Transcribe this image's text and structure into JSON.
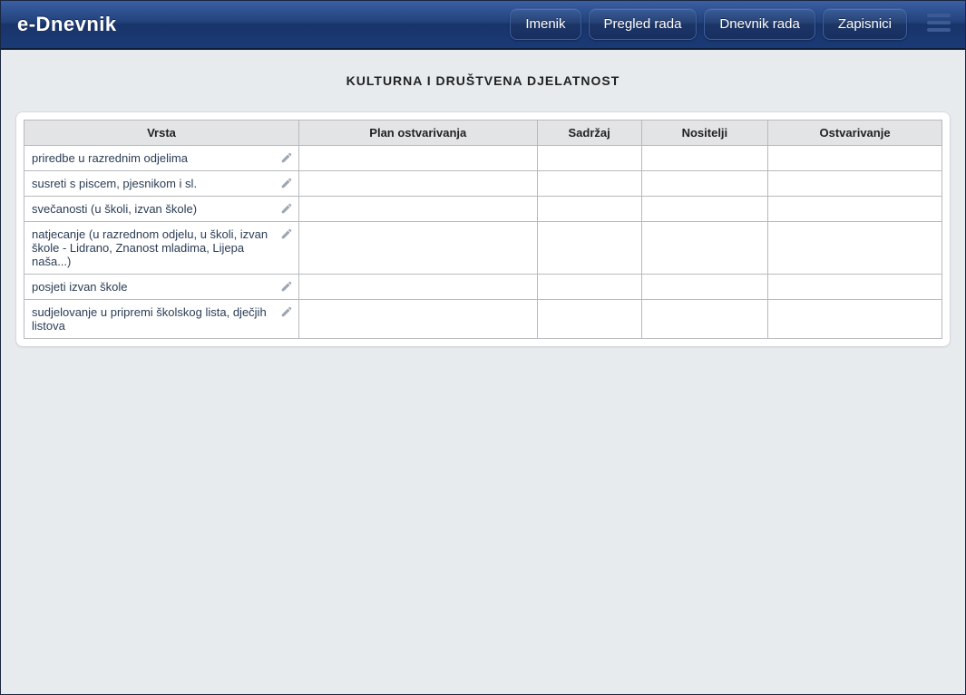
{
  "header": {
    "brand": "e-Dnevnik",
    "nav": [
      {
        "label": "Imenik"
      },
      {
        "label": "Pregled rada"
      },
      {
        "label": "Dnevnik rada"
      },
      {
        "label": "Zapisnici"
      }
    ]
  },
  "page_title": "KULTURNA I DRUŠTVENA DJELATNOST",
  "table": {
    "headers": {
      "vrsta": "Vrsta",
      "plan": "Plan ostvarivanja",
      "sadrzaj": "Sadržaj",
      "nositelji": "Nositelji",
      "ostvarivanje": "Ostvarivanje"
    },
    "rows": [
      {
        "vrsta": "priredbe u razrednim odjelima",
        "plan": "",
        "sadrzaj": "",
        "nositelji": "",
        "ostvarivanje": ""
      },
      {
        "vrsta": "susreti s piscem, pjesnikom i sl.",
        "plan": "",
        "sadrzaj": "",
        "nositelji": "",
        "ostvarivanje": ""
      },
      {
        "vrsta": "svečanosti (u školi, izvan škole)",
        "plan": "",
        "sadrzaj": "",
        "nositelji": "",
        "ostvarivanje": ""
      },
      {
        "vrsta": "natjecanje (u razrednom odjelu, u školi, izvan škole - Lidrano, Znanost mladima, Lijepa naša...)",
        "plan": "",
        "sadrzaj": "",
        "nositelji": "",
        "ostvarivanje": ""
      },
      {
        "vrsta": "posjeti izvan škole",
        "plan": "",
        "sadrzaj": "",
        "nositelji": "",
        "ostvarivanje": ""
      },
      {
        "vrsta": "sudjelovanje u pripremi školskog lista, dječjih listova",
        "plan": "",
        "sadrzaj": "",
        "nositelji": "",
        "ostvarivanje": ""
      }
    ]
  }
}
